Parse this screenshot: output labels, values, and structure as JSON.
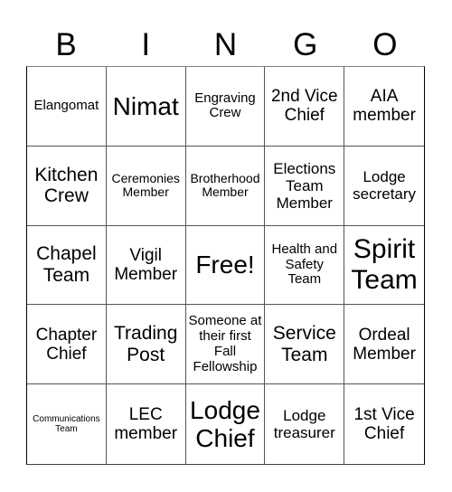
{
  "title": {
    "letters": [
      "B",
      "I",
      "N",
      "G",
      "O"
    ]
  },
  "board": {
    "rows": [
      [
        {
          "text": "Elangomat",
          "size": "fs-m"
        },
        {
          "text": "Nimat",
          "size": "fs-xxl"
        },
        {
          "text": "Engraving Crew",
          "size": "fs-m"
        },
        {
          "text": "2nd Vice Chief",
          "size": "fs-l"
        },
        {
          "text": "AIA member",
          "size": "fs-l"
        }
      ],
      [
        {
          "text": "Kitchen Crew",
          "size": "fs-xl"
        },
        {
          "text": "Ceremonies Member",
          "size": "fs-s"
        },
        {
          "text": "Brotherhood Member",
          "size": "fs-s"
        },
        {
          "text": "Elections Team Member",
          "size": "fs-ml"
        },
        {
          "text": "Lodge secretary",
          "size": "fs-ml"
        }
      ],
      [
        {
          "text": "Chapel Team",
          "size": "fs-xl"
        },
        {
          "text": "Vigil Member",
          "size": "fs-l"
        },
        {
          "text": "Free!",
          "size": "fs-xxl"
        },
        {
          "text": "Health and Safety Team",
          "size": "fs-m"
        },
        {
          "text": "Spirit Team",
          "size": "fs-xxxl"
        }
      ],
      [
        {
          "text": "Chapter Chief",
          "size": "fs-l"
        },
        {
          "text": "Trading Post",
          "size": "fs-xl"
        },
        {
          "text": "Someone at their first Fall Fellowship",
          "size": "fs-m"
        },
        {
          "text": "Service Team",
          "size": "fs-xl"
        },
        {
          "text": "Ordeal Member",
          "size": "fs-l"
        }
      ],
      [
        {
          "text": "Communications Team",
          "size": "fs-xs"
        },
        {
          "text": "LEC member",
          "size": "fs-l"
        },
        {
          "text": "Lodge Chief",
          "size": "fs-xxl"
        },
        {
          "text": "Lodge treasurer",
          "size": "fs-ml"
        },
        {
          "text": "1st Vice Chief",
          "size": "fs-l"
        }
      ]
    ]
  }
}
